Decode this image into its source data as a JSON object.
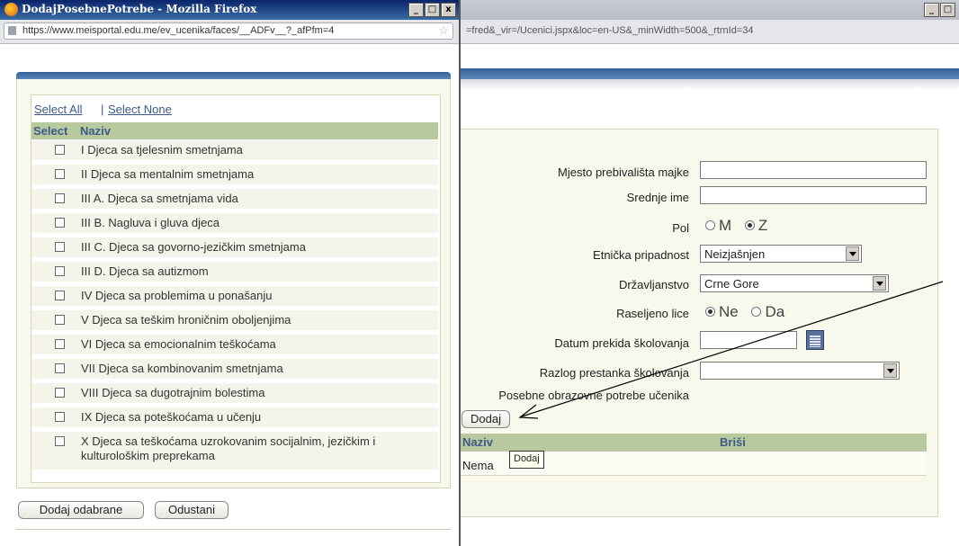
{
  "popup": {
    "title": "DodajPosebnePotrebe - Mozilla Firefox",
    "url": "https://www.meisportal.edu.me/ev_ucenika/faces/__ADFv__?_afPfm=4",
    "window_buttons": [
      "_",
      "□",
      "x"
    ],
    "select_all": "Select All",
    "separator": "|",
    "select_none": "Select None",
    "col_select": "Select",
    "col_naziv": "Naziv",
    "items": [
      "I Djeca sa tjelesnim smetnjama",
      "II Djeca sa mentalnim smetnjama",
      "III A. Djeca sa smetnjama vida",
      "III B. Nagluva i gluva djeca",
      "III C. Djeca sa govorno-jezičkim smetnjama",
      "III D. Djeca sa autizmom",
      "IV Djeca sa problemima u ponašanju",
      "V Djeca sa teškim hroničnim oboljenjima",
      "VI Djeca sa emocionalnim teškoćama",
      "VII Djeca sa kombinovanim smetnjama",
      "VIII Djeca sa dugotrajnim bolestima",
      "IX Djeca sa poteškoćama u učenju",
      "X Djeca sa teškoćama uzrokovanim socijalnim, jezičkim i kulturološkim preprekama"
    ],
    "add_selected_button": "Dodaj odabrane",
    "cancel_button": "Odustani"
  },
  "main": {
    "url": "=fred&_vir=/Ucenici.jspx&loc=en-US&_minWidth=500&_rtrnId=34",
    "window_buttons": [
      "_",
      "□"
    ],
    "labels": {
      "mjesto": "Mjesto prebivališta majke",
      "srednje_ime": "Srednje ime",
      "pol": "Pol",
      "etnicka": "Etnička pripadnost",
      "drzavljanstvo": "Državljanstvo",
      "raseljeno": "Raseljeno lice",
      "datum_prekida": "Datum prekida školovanja",
      "razlog": "Razlog prestanka školovanja",
      "posebne": "Posebne obrazovne potrebe učenika"
    },
    "pol_options": [
      "M",
      "Z"
    ],
    "pol_selected": "Z",
    "etnicka_value": "Neizjašnjen",
    "drzavljanstvo_value": "Crne Gore",
    "raseljeno_options": [
      "Ne",
      "Da"
    ],
    "raseljeno_selected": "Ne",
    "razlog_value": "",
    "add_button": "Dodaj",
    "table_headers": [
      "Naziv",
      "Briši"
    ],
    "table_empty": "Nema",
    "tooltip": "Dodaj"
  },
  "colors": {
    "title_bar": "#0a246a",
    "header_band": "#34639a",
    "table_header": "#b8c9a0",
    "panel": "#f8f8ed",
    "link": "#3b5a88"
  }
}
